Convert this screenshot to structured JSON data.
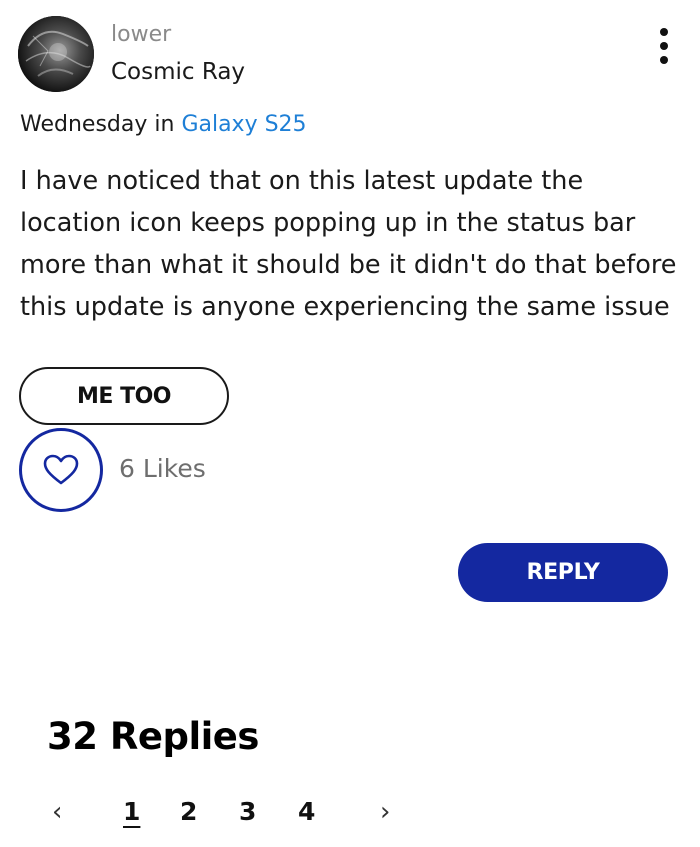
{
  "author": {
    "rank": "lower",
    "name": "Cosmic Ray",
    "avatar_icon": "avatar-photo"
  },
  "post": {
    "date": "Wednesday",
    "in_word": "in",
    "board": "Galaxy S25",
    "body": "I have noticed that on this latest update the location icon keeps popping up in the status bar more than what it should be it didn't do that before this update is anyone experiencing the same issue"
  },
  "actions": {
    "more_icon": "vertical-ellipsis-icon",
    "metoo_label": "ME TOO",
    "like_icon": "heart-icon",
    "likes_label": "6 Likes",
    "likes_count": 6,
    "reply_label": "REPLY"
  },
  "replies": {
    "title": "32 Replies",
    "count": 32
  },
  "pagination": {
    "prev": "‹",
    "next": "›",
    "pages": [
      "1",
      "2",
      "3",
      "4"
    ],
    "current": "1"
  },
  "colors": {
    "accent": "#1428a0",
    "link": "#1e7fd6",
    "muted": "#8a8a8a"
  }
}
